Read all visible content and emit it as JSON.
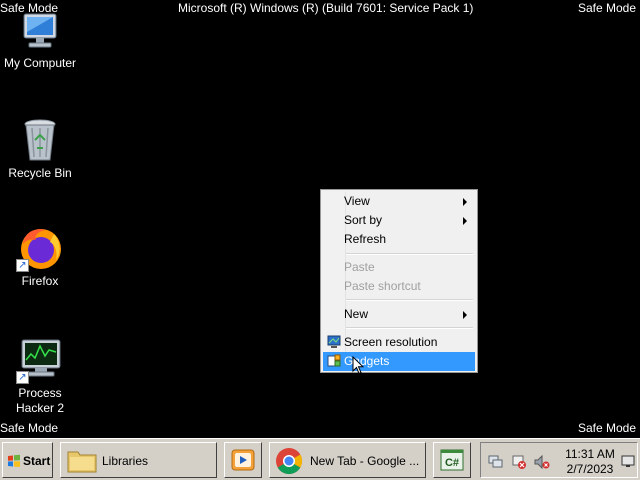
{
  "watermark": {
    "top_left": "Safe Mode",
    "top_right": "Safe Mode",
    "bottom_left": "Safe Mode",
    "bottom_right": "Safe Mode",
    "title": "Microsoft (R) Windows (R) (Build 7601: Service Pack 1)"
  },
  "desktop": {
    "icons": [
      {
        "label": "My Computer",
        "icon": "computer-icon"
      },
      {
        "label": "Recycle Bin",
        "icon": "recycle-bin-icon"
      },
      {
        "label": "Firefox",
        "icon": "firefox-icon"
      },
      {
        "label": "Process Hacker 2",
        "icon": "process-hacker-icon"
      }
    ]
  },
  "context_menu": {
    "items": [
      {
        "label": "View",
        "submenu": true,
        "enabled": true
      },
      {
        "label": "Sort by",
        "submenu": true,
        "enabled": true
      },
      {
        "label": "Refresh",
        "enabled": true
      },
      {
        "label": "Paste",
        "enabled": false
      },
      {
        "label": "Paste shortcut",
        "enabled": false
      },
      {
        "label": "New",
        "submenu": true,
        "enabled": true
      },
      {
        "label": "Screen resolution",
        "icon": "display-icon",
        "enabled": true
      },
      {
        "label": "Gadgets",
        "icon": "gadgets-icon",
        "enabled": true,
        "highlighted": true
      }
    ]
  },
  "taskbar": {
    "start_label": "Start",
    "buttons": [
      {
        "label": "Libraries",
        "icon": "folder-icon"
      },
      {
        "label": "",
        "icon": "media-player-icon"
      },
      {
        "label": "New Tab - Google ...",
        "icon": "chrome-icon"
      },
      {
        "label": "",
        "icon": "csharp-icon"
      }
    ],
    "tray": {
      "icons": [
        "network-icon",
        "action-center-icon",
        "volume-muted-icon"
      ],
      "time": "11:31 AM",
      "date": "2/7/2023"
    }
  },
  "colors": {
    "desktop_bg": "#000000",
    "menu_highlight": "#3399ff",
    "taskbar_bg": "#d4d0c8"
  }
}
